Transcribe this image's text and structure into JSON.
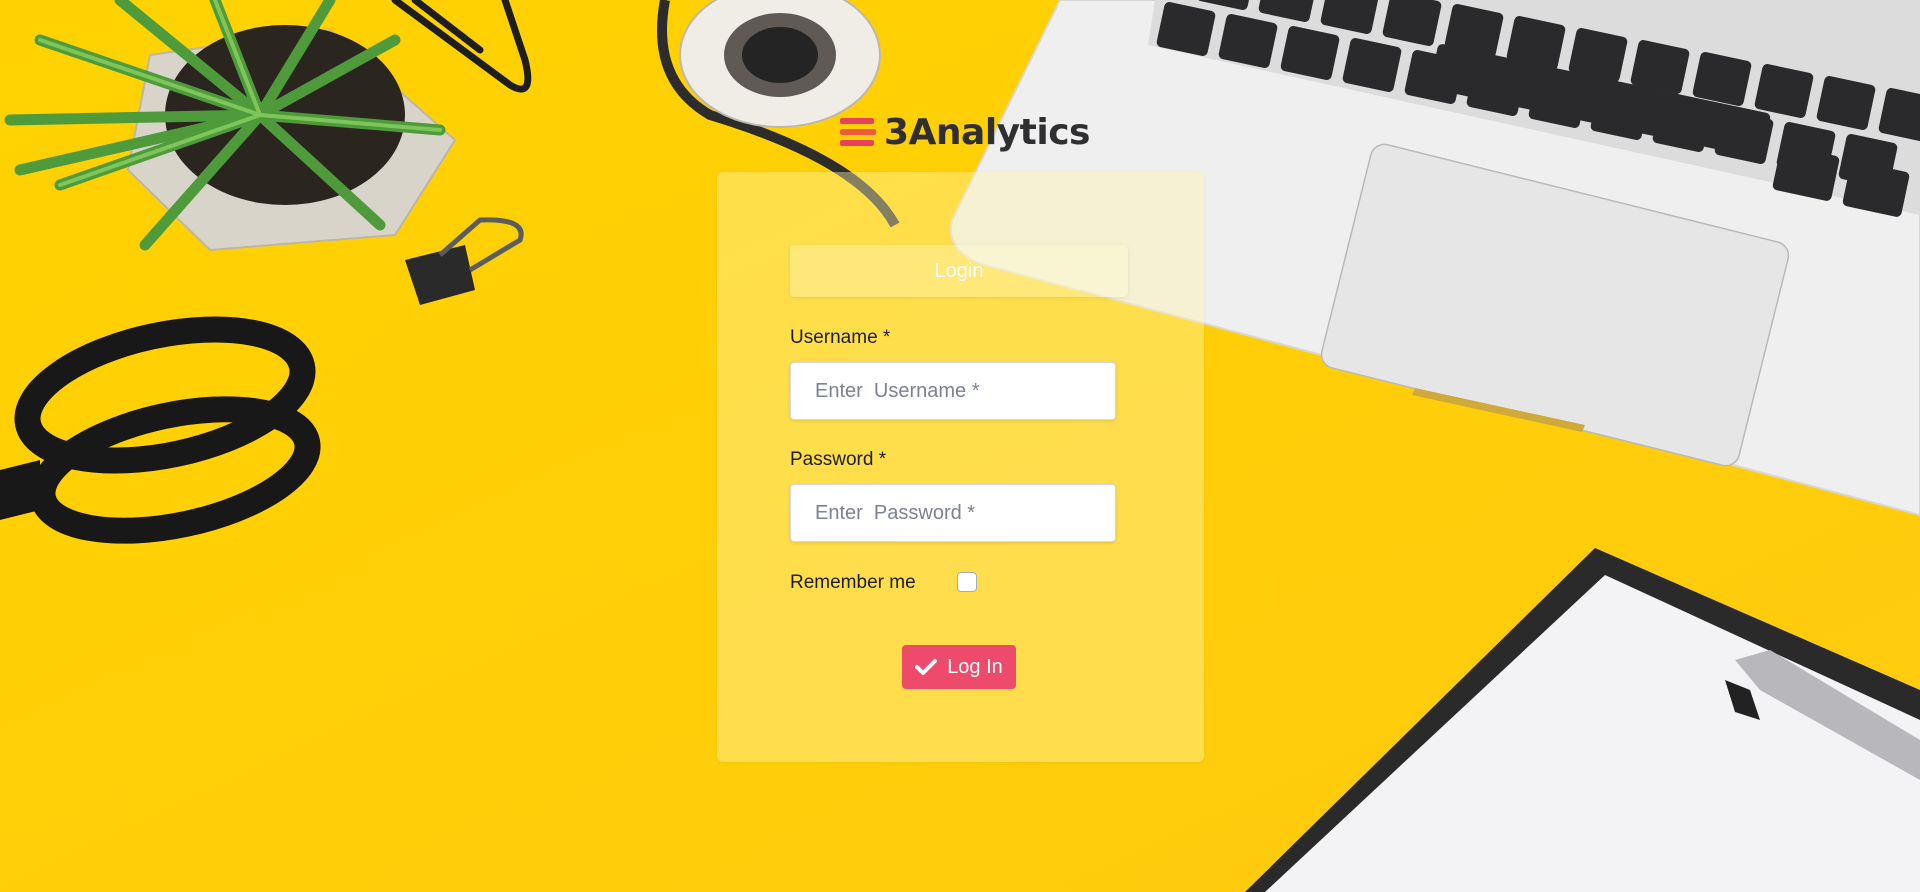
{
  "brand": {
    "name": "3Analytics",
    "colors": {
      "accent": "#ee4a6c",
      "logo_bar_primary": "#e8405f",
      "logo_bar_secondary": "#ef5a3c",
      "background": "#ffd21a"
    }
  },
  "login_form": {
    "header_label": "Login",
    "username": {
      "label": "Username *",
      "placeholder": "Enter  Username *",
      "value": ""
    },
    "password": {
      "label": "Password *",
      "placeholder": "Enter  Password *",
      "value": ""
    },
    "remember_me": {
      "label": "Remember me",
      "checked": false
    },
    "submit": {
      "label": "Log In",
      "icon": "check-icon"
    }
  },
  "icons": {
    "logo": "three-bars-logo-icon",
    "submit": "check-icon"
  }
}
